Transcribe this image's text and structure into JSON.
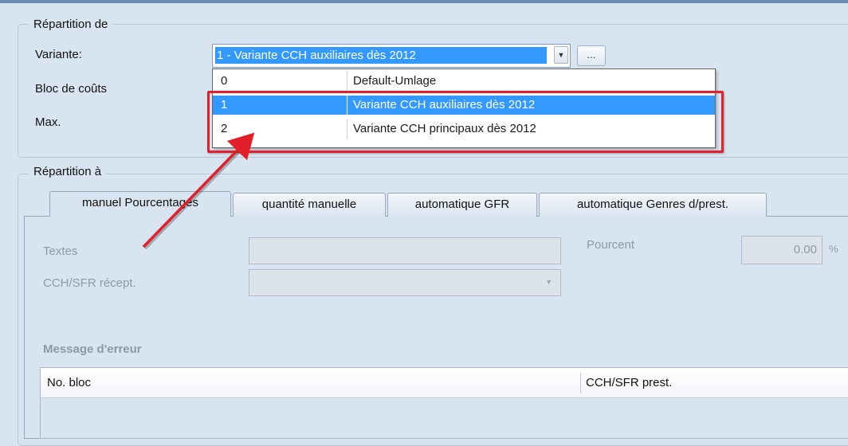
{
  "repartition_de": {
    "legend": "Répartition de",
    "variante_label": "Variante:",
    "variante_value": "1 - Variante CCH auxiliaires dès 2012",
    "ellipsis_label": "...",
    "bloc_label": "Bloc de coûts",
    "max_label": "Max.",
    "dropdown_options": [
      {
        "code": "0",
        "name": "Default-Umlage"
      },
      {
        "code": "1",
        "name": "Variante CCH auxiliaires dès 2012"
      },
      {
        "code": "2",
        "name": "Variante CCH principaux dès 2012"
      }
    ]
  },
  "repartition_a": {
    "legend": "Répartition à",
    "tabs": [
      {
        "label": "manuel Pourcentages"
      },
      {
        "label": "quantité manuelle"
      },
      {
        "label": "automatique GFR"
      },
      {
        "label": "automatique Genres d/prest."
      }
    ],
    "textes_label": "Textes",
    "pourcent_label": "Pourcent",
    "pourcent_value": "0.00",
    "pourcent_unit": "%",
    "cch_label": "CCH/SFR récept.",
    "error_title": "Message d'erreur",
    "grid_columns": [
      "No. bloc",
      "CCH/SFR prest."
    ]
  },
  "colors": {
    "accent": "#3399ff",
    "highlight_box": "#e3202a",
    "background": "#d9e4f1"
  }
}
